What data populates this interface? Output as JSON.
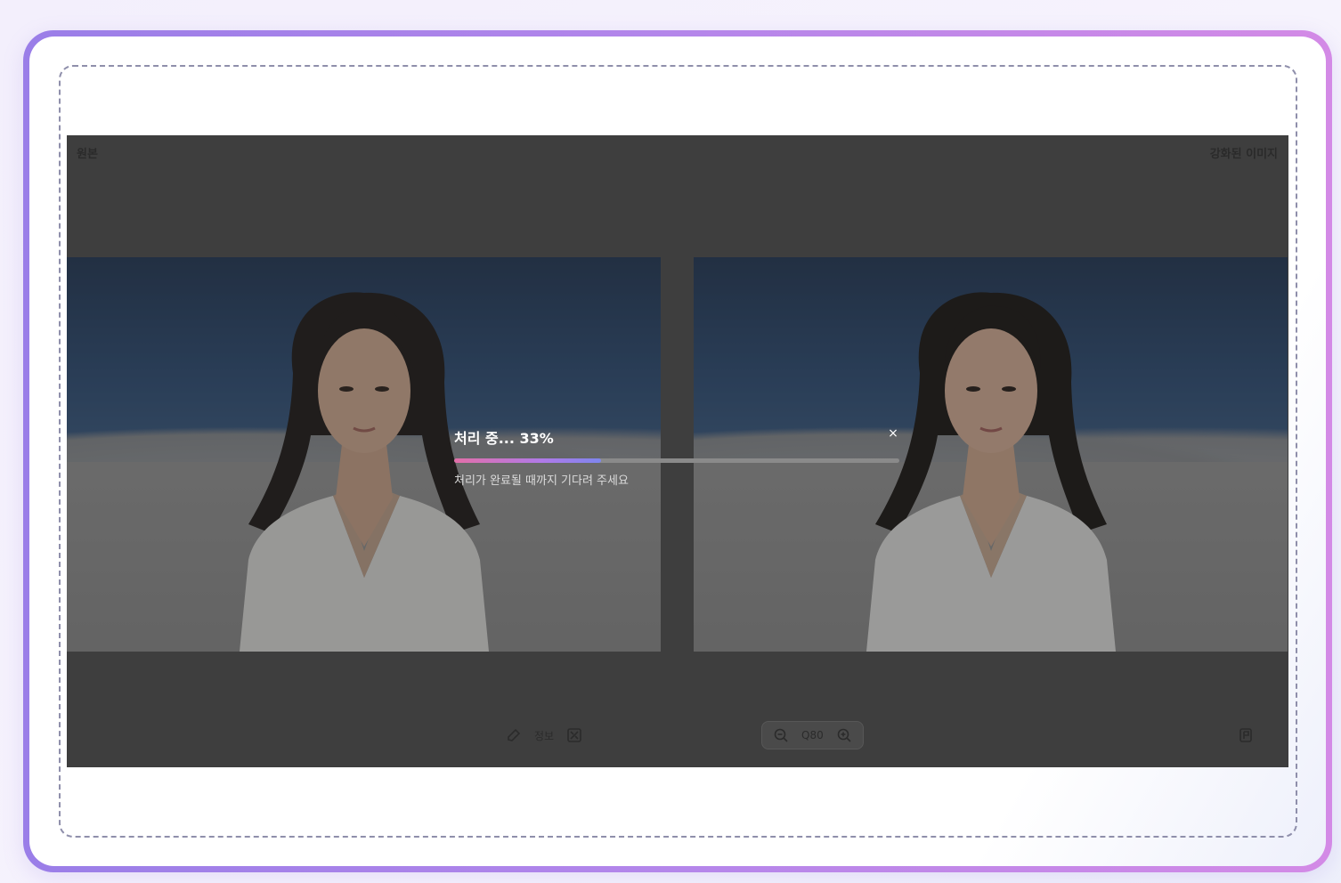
{
  "viewer": {
    "label_original": "원본",
    "label_enhanced": "강화된 이미지"
  },
  "toolbar": {
    "info_label": "정보",
    "zoom_value": "Q80"
  },
  "progress": {
    "title": "처리 중... 33%",
    "subtitle": "처리가 완료될 때까지 기다려 주세요",
    "percent": 33,
    "close_symbol": "×"
  },
  "icons": {
    "edit": "edit-icon",
    "compare": "compare-icon",
    "zoom_out": "zoom-out-icon",
    "zoom_in": "zoom-in-icon",
    "flag": "flag-icon",
    "close": "close-icon"
  },
  "colors": {
    "frame_gradient_start": "#9a7ee8",
    "frame_gradient_end": "#d38ae6",
    "progress_start": "#e36fa8",
    "progress_end": "#7e86ee",
    "viewer_bg": "#4e4e4e"
  }
}
